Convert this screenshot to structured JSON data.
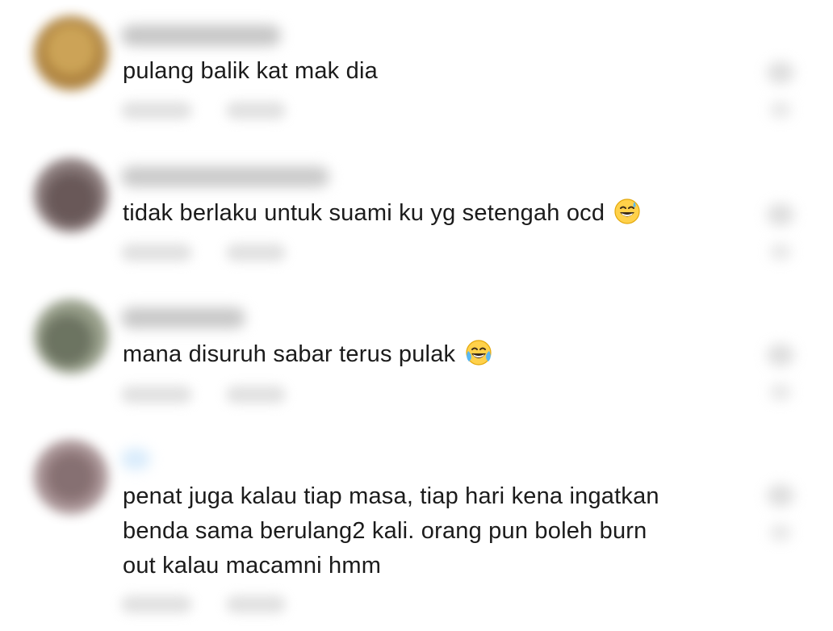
{
  "comments": [
    {
      "text": "pulang balik kat mak dia",
      "emoji": "",
      "avatar_color": "#b8873a"
    },
    {
      "text": "tidak berlaku untuk suami ku yg setengah ocd",
      "emoji": "grinning-sweat-emoji",
      "avatar_color": "#6a5a5a"
    },
    {
      "text": "mana disuruh sabar terus pulak",
      "emoji": "tears-of-joy-emoji",
      "avatar_color": "#77806b"
    },
    {
      "text_lines": [
        "penat juga kalau tiap masa, tiap hari kena ingatkan",
        "benda sama berulang2 kali. orang pun boleh burn",
        "out kalau macamni hmm"
      ],
      "emoji": "",
      "avatar_color": "#8c7072"
    }
  ]
}
